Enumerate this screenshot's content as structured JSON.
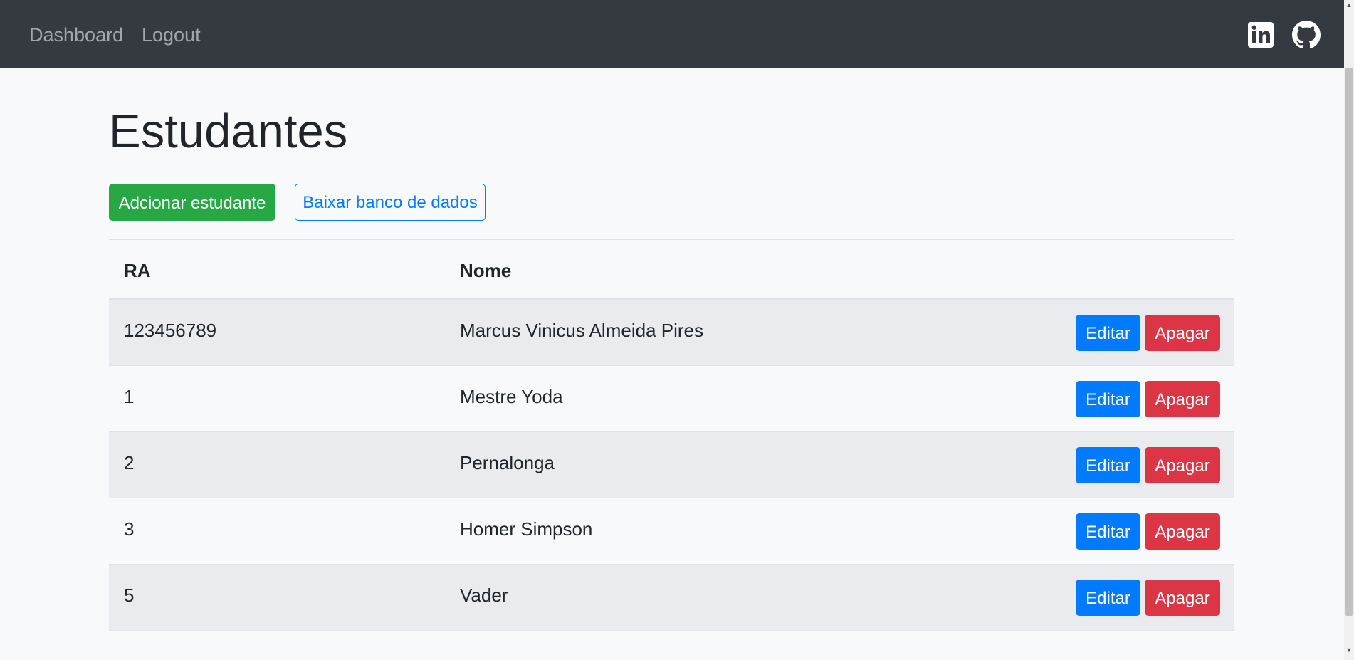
{
  "navbar": {
    "links": {
      "dashboard": "Dashboard",
      "logout": "Logout"
    },
    "social": [
      "linkedin-icon",
      "github-icon"
    ]
  },
  "main": {
    "title": "Estudantes",
    "add_button": "Adcionar estudante",
    "download_button": "Baixar banco de dados",
    "table": {
      "headers": [
        "RA",
        "Nome"
      ],
      "rows": [
        {
          "ra": "123456789",
          "nome": "Marcus Vinicus Almeida Pires"
        },
        {
          "ra": "1",
          "nome": "Mestre Yoda"
        },
        {
          "ra": "2",
          "nome": "Pernalonga"
        },
        {
          "ra": "3",
          "nome": "Homer Simpson"
        },
        {
          "ra": "5",
          "nome": "Vader"
        }
      ],
      "edit_label": "Editar",
      "delete_label": "Apagar"
    }
  },
  "colors": {
    "navbar": "#343a40",
    "success": "#28a745",
    "primary": "#007bff",
    "danger": "#dc3545",
    "background": "#f8f9fa"
  }
}
